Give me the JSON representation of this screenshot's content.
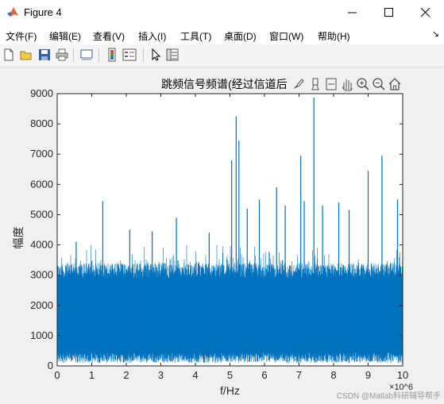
{
  "window": {
    "title": "Figure 4",
    "controls": [
      "minimize",
      "maximize",
      "close"
    ]
  },
  "menu": {
    "items": [
      "文件(F)",
      "编辑(E)",
      "查看(V)",
      "插入(I)",
      "工具(T)",
      "桌面(D)",
      "窗口(W)",
      "帮助(H)"
    ],
    "overflow": "↘"
  },
  "toolbar": {
    "buttons": [
      "new-figure-icon",
      "open-file-icon",
      "save-icon",
      "print-icon",
      "link-plot-icon",
      "insert-colorbar-icon",
      "insert-legend-icon",
      "edit-plot-pointer-icon",
      "property-inspector-icon"
    ]
  },
  "axes_toolbar": {
    "buttons": [
      "brush-icon",
      "data-tips-icon",
      "export-icon",
      "pan-icon",
      "zoom-in-icon",
      "zoom-out-icon",
      "home-icon"
    ]
  },
  "colors": {
    "series": "#0072bd",
    "axes_bg": "#ffffff",
    "figure_bg": "#f0f0f0"
  },
  "chart_data": {
    "type": "line",
    "title": "跳频信号频谱(经过信道后",
    "xlabel": "f/Hz",
    "ylabel": "幅度",
    "x_exponent": "×10^6",
    "xlim": [
      0,
      10
    ],
    "ylim": [
      0,
      9000
    ],
    "xticks": [
      0,
      1,
      2,
      3,
      4,
      5,
      6,
      7,
      8,
      9,
      10
    ],
    "yticks": [
      0,
      1000,
      2000,
      3000,
      4000,
      5000,
      6000,
      7000,
      8000,
      9000
    ],
    "grid": false,
    "series": [
      {
        "baseline_band": [
          100,
          3400
        ],
        "peaks": [
          {
            "x": 0.55,
            "y": 4100
          },
          {
            "x": 1.32,
            "y": 5450
          },
          {
            "x": 2.1,
            "y": 4500
          },
          {
            "x": 2.75,
            "y": 4450
          },
          {
            "x": 3.45,
            "y": 4900
          },
          {
            "x": 4.4,
            "y": 4400
          },
          {
            "x": 5.05,
            "y": 6800
          },
          {
            "x": 5.18,
            "y": 8250
          },
          {
            "x": 5.26,
            "y": 7450
          },
          {
            "x": 5.5,
            "y": 5200
          },
          {
            "x": 5.85,
            "y": 5500
          },
          {
            "x": 6.35,
            "y": 5900
          },
          {
            "x": 6.6,
            "y": 5300
          },
          {
            "x": 7.05,
            "y": 6950
          },
          {
            "x": 7.15,
            "y": 5450
          },
          {
            "x": 7.43,
            "y": 8870
          },
          {
            "x": 7.68,
            "y": 5300
          },
          {
            "x": 8.15,
            "y": 5400
          },
          {
            "x": 8.45,
            "y": 5150
          },
          {
            "x": 9.0,
            "y": 6450
          },
          {
            "x": 9.4,
            "y": 6950
          },
          {
            "x": 9.85,
            "y": 5500
          }
        ]
      }
    ]
  },
  "watermark": "CSDN @Matlab科研辅导帮手"
}
